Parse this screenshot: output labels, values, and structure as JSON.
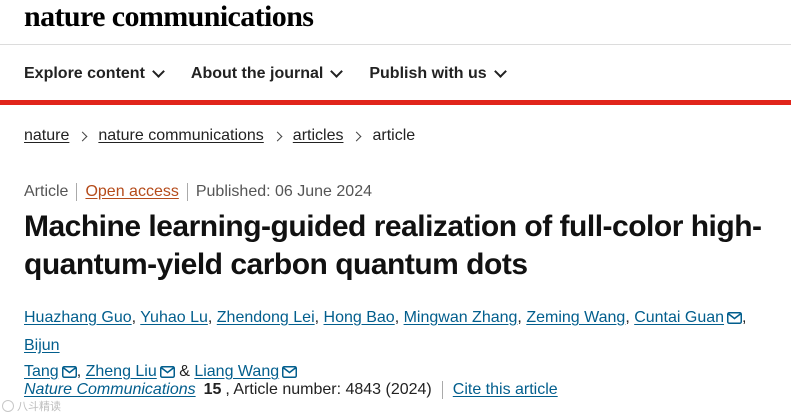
{
  "site": {
    "brand": "nature communications"
  },
  "nav": {
    "items": [
      {
        "label": "Explore content"
      },
      {
        "label": "About the journal"
      },
      {
        "label": "Publish with us"
      }
    ]
  },
  "breadcrumb": [
    "nature",
    "nature communications",
    "articles",
    "article"
  ],
  "meta": {
    "type": "Article",
    "access": "Open access",
    "published": "Published: 06 June 2024"
  },
  "title": {
    "line1": "Machine learning-guided realization of full-color high-",
    "line2": "quantum-yield carbon quantum dots"
  },
  "authors": {
    "a1": "Huazhang Guo",
    "a2": "Yuhao Lu",
    "a3": "Zhendong Lei",
    "a4": "Hong Bao",
    "a5": "Mingwan Zhang",
    "a6": "Zeming Wang",
    "a7": "Cuntai Guan",
    "a8a": "Bijun",
    "a8b": "Tang",
    "a9": "Zheng Liu",
    "a10": "Liang Wang",
    "sep": ", ",
    "amp": " & "
  },
  "citation": {
    "journal": "Nature Communications",
    "volume": "15",
    "article_number": ", Article number: 4843 (2024)",
    "cite_label": "Cite this article"
  },
  "watermark": {
    "text": "八斗精读"
  },
  "colors": {
    "accent_red": "#e1251b",
    "link_blue": "#025e8d",
    "open_access": "#b54b1a"
  }
}
